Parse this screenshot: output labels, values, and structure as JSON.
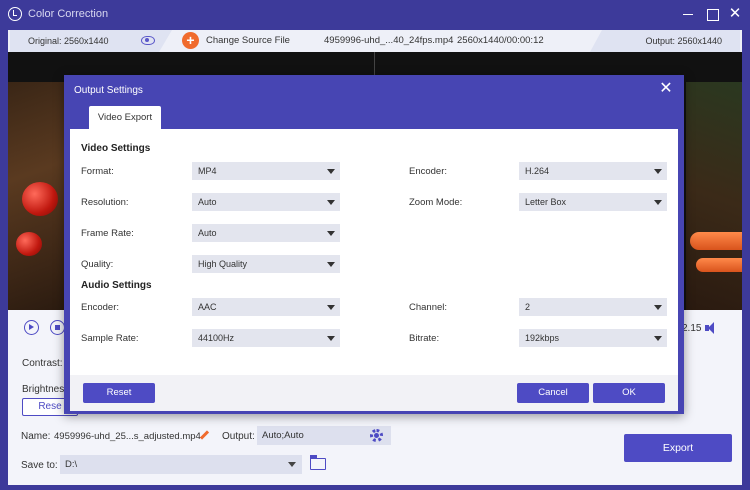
{
  "app": {
    "title": "Color Correction"
  },
  "toolbar": {
    "original_label": "Original: 2560x1440",
    "change_source_label": "Change Source File",
    "file_name": "4959996-uhd_...40_24fps.mp4",
    "file_meta": "2560x1440/00:00:12",
    "output_label": "Output: 2560x1440"
  },
  "player": {
    "time": "2.15"
  },
  "adjust": {
    "contrast_label": "Contrast:",
    "brightness_label": "Brightness",
    "reset_label": "Rese"
  },
  "export_bar": {
    "name_label": "Name:",
    "name_value": "4959996-uhd_25...s_adjusted.mp4",
    "output_label": "Output:",
    "output_value": "Auto;Auto",
    "save_to_label": "Save to:",
    "save_to_value": "D:\\",
    "export_label": "Export"
  },
  "modal": {
    "title": "Output Settings",
    "tab_label": "Video Export",
    "video_section": "Video Settings",
    "audio_section": "Audio Settings",
    "format_label": "Format:",
    "format_value": "MP4",
    "encoder_label": "Encoder:",
    "encoder_value": "H.264",
    "resolution_label": "Resolution:",
    "resolution_value": "Auto",
    "zoom_label": "Zoom Mode:",
    "zoom_value": "Letter Box",
    "framerate_label": "Frame Rate:",
    "framerate_value": "Auto",
    "quality_label": "Quality:",
    "quality_value": "High Quality",
    "audio_encoder_label": "Encoder:",
    "audio_encoder_value": "AAC",
    "channel_label": "Channel:",
    "channel_value": "2",
    "samplerate_label": "Sample Rate:",
    "samplerate_value": "44100Hz",
    "bitrate_label": "Bitrate:",
    "bitrate_value": "192kbps",
    "reset_label": "Reset",
    "cancel_label": "Cancel",
    "ok_label": "OK"
  },
  "colors": {
    "accent": "#4e4bc4",
    "title_bar": "#3d3a9a",
    "orange": "#f06b2d"
  }
}
